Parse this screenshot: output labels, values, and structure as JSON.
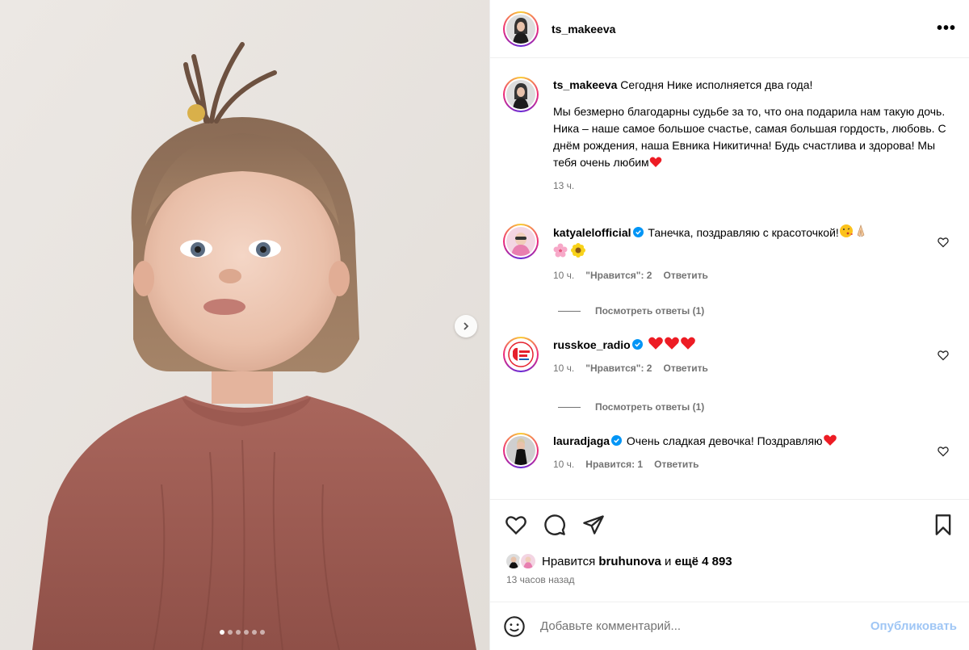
{
  "post": {
    "author": "ts_makeeva",
    "more_icon": "more-horizontal-icon",
    "carousel": {
      "slides": 6,
      "active_index": 0
    }
  },
  "caption": {
    "username": "ts_makeeva",
    "line1": "Сегодня Нике исполняется два года!",
    "body": "Мы безмерно благодарны судьбе за то, что она подарила нам такую дочь. Ника – наше самое большое счастье, самая большая гордость, любовь. С днём рождения, наша Евника Никитична! Будь счастлива и здорова! Мы тебя очень любим",
    "time": "13 ч."
  },
  "comments": [
    {
      "username": "katyalelofficial",
      "verified": true,
      "text": "Танечка, поздравляю с красоточкой!",
      "emojis": [
        "face-blowing-kiss",
        "folded-hands",
        "cherry-blossom",
        "sunflower"
      ],
      "time": "10 ч.",
      "likes": "\"Нравится\": 2",
      "reply": "Ответить",
      "view_replies": "Посмотреть ответы (1)"
    },
    {
      "username": "russkoe_radio",
      "verified": true,
      "text": "",
      "emojis": [
        "red-heart",
        "red-heart",
        "red-heart"
      ],
      "time": "10 ч.",
      "likes": "\"Нравится\": 2",
      "reply": "Ответить",
      "view_replies": "Посмотреть ответы (1)"
    },
    {
      "username": "lauradjaga",
      "verified": true,
      "text": "Очень сладкая девочка! Поздравляю",
      "emojis": [
        "red-heart"
      ],
      "time": "10 ч.",
      "likes": "Нравится: 1",
      "reply": "Ответить"
    }
  ],
  "actions": {
    "like_icon": "heart-icon",
    "comment_icon": "comment-icon",
    "share_icon": "share-icon",
    "save_icon": "bookmark-icon"
  },
  "likes_summary": {
    "prefix": "Нравится",
    "user": "bruhunova",
    "and": "и",
    "count": "ещё 4 893"
  },
  "posted_ago": "13 часов назад",
  "comment_input": {
    "placeholder": "Добавьте комментарий...",
    "publish_label": "Опубликовать"
  },
  "colors": {
    "link_disabled": "#9fc6f5",
    "secondary_text": "#737373",
    "verified_blue": "#0095f6",
    "heart_red": "#ed1c24"
  }
}
